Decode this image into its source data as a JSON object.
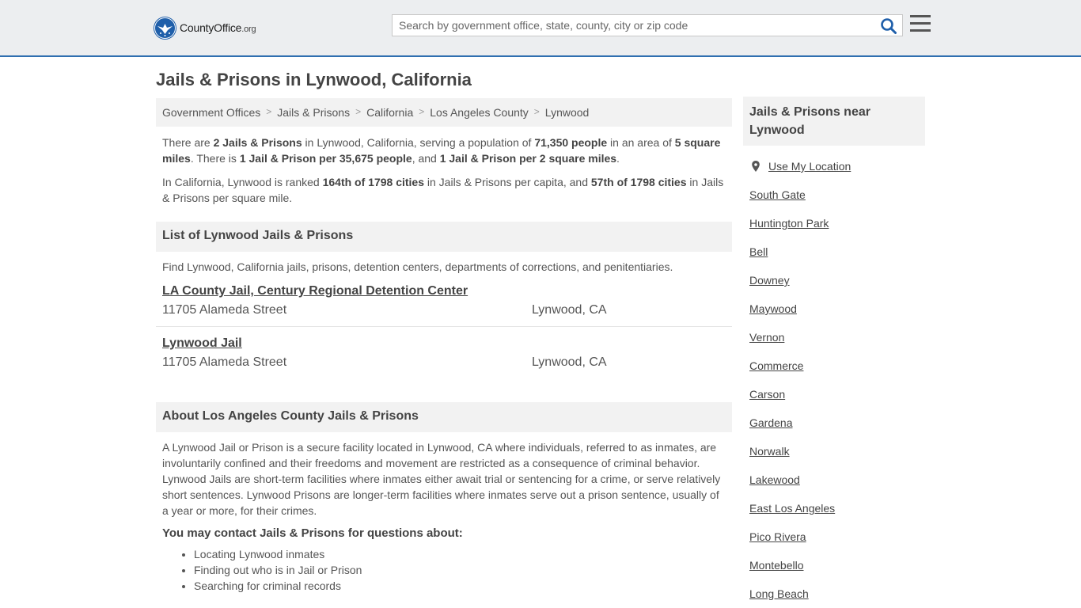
{
  "header": {
    "logo_main": "CountyOffice",
    "logo_tld": ".org",
    "search_placeholder": "Search by government office, state, county, city or zip code"
  },
  "page_title": "Jails & Prisons in Lynwood, California",
  "breadcrumbs": [
    "Government Offices",
    "Jails & Prisons",
    "California",
    "Los Angeles County",
    "Lynwood"
  ],
  "intro": {
    "p1": [
      {
        "t": "There are ",
        "b": false
      },
      {
        "t": "2 Jails & Prisons",
        "b": true
      },
      {
        "t": " in Lynwood, California, serving a population of ",
        "b": false
      },
      {
        "t": "71,350 people",
        "b": true
      },
      {
        "t": " in an area of ",
        "b": false
      },
      {
        "t": "5 square miles",
        "b": true
      },
      {
        "t": ". There is ",
        "b": false
      },
      {
        "t": "1 Jail & Prison per 35,675 people",
        "b": true
      },
      {
        "t": ", and ",
        "b": false
      },
      {
        "t": "1 Jail & Prison per 2 square miles",
        "b": true
      },
      {
        "t": ".",
        "b": false
      }
    ],
    "p2": [
      {
        "t": "In California, Lynwood is ranked ",
        "b": false
      },
      {
        "t": "164th of 1798 cities",
        "b": true
      },
      {
        "t": " in Jails & Prisons per capita, and ",
        "b": false
      },
      {
        "t": "57th of 1798 cities",
        "b": true
      },
      {
        "t": " in Jails & Prisons per square mile.",
        "b": false
      }
    ]
  },
  "list_section": {
    "heading": "List of Lynwood Jails & Prisons",
    "description": "Find Lynwood, California jails, prisons, detention centers, departments of corrections, and penitentiaries.",
    "listings": [
      {
        "name": "LA County Jail, Century Regional Detention Center",
        "address": "11705 Alameda Street",
        "city": "Lynwood, CA"
      },
      {
        "name": "Lynwood Jail",
        "address": "11705 Alameda Street",
        "city": "Lynwood, CA"
      }
    ]
  },
  "about_section": {
    "heading": "About Los Angeles County Jails & Prisons",
    "body": "A Lynwood Jail or Prison is a secure facility located in Lynwood, CA where individuals, referred to as inmates, are involuntarily confined and their freedoms and movement are restricted as a consequence of criminal behavior. Lynwood Jails are short-term facilities where inmates either await trial or sentencing for a crime, or serve relatively short sentences. Lynwood Prisons are longer-term facilities where inmates serve out a prison sentence, usually of a year or more, for their crimes.",
    "contact_heading": "You may contact Jails & Prisons for questions about:",
    "contact_items": [
      "Locating Lynwood inmates",
      "Finding out who is in Jail or Prison",
      "Searching for criminal records"
    ]
  },
  "sidebar": {
    "heading": "Jails & Prisons near Lynwood",
    "use_location": "Use My Location",
    "cities": [
      "South Gate",
      "Huntington Park",
      "Bell",
      "Downey",
      "Maywood",
      "Vernon",
      "Commerce",
      "Carson",
      "Gardena",
      "Norwalk",
      "Lakewood",
      "East Los Angeles",
      "Pico Rivera",
      "Montebello",
      "Long Beach"
    ]
  }
}
